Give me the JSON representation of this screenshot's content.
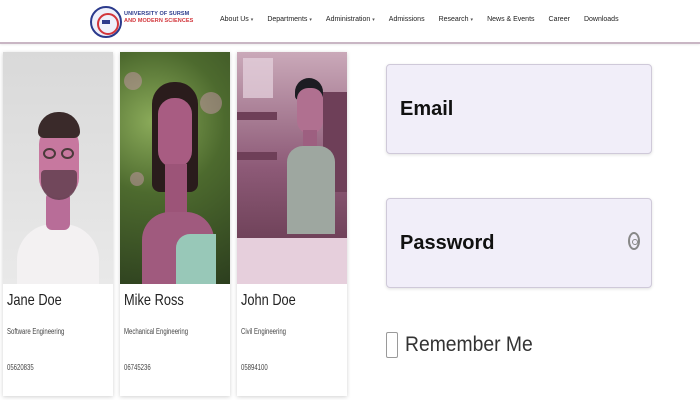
{
  "header": {
    "brand_line1": "UNIVERSITY OF SURSM",
    "brand_line2": "AND MODERN SCIENCES",
    "nav": [
      {
        "label": "About Us",
        "dropdown": true
      },
      {
        "label": "Departments",
        "dropdown": true
      },
      {
        "label": "Administration",
        "dropdown": true
      },
      {
        "label": "Admissions",
        "dropdown": false
      },
      {
        "label": "Research",
        "dropdown": true
      },
      {
        "label": "News & Events",
        "dropdown": false
      },
      {
        "label": "Career",
        "dropdown": false
      },
      {
        "label": "Downloads",
        "dropdown": false
      }
    ]
  },
  "cards": [
    {
      "name": "Jane Doe",
      "department": "Software Engineering",
      "code": "05620835"
    },
    {
      "name": "Mike Ross",
      "department": "Mechanical Engineering",
      "code": "06745236"
    },
    {
      "name": "John Doe",
      "department": "Civil Engineering",
      "code": "05894100"
    }
  ],
  "login": {
    "email_placeholder": "Email",
    "password_placeholder": "Password",
    "password_toggle_icon": "eye-icon",
    "remember_label": "Remember Me"
  },
  "colors": {
    "brand_blue": "#2b3a8c",
    "brand_red": "#d2353b",
    "field_bg": "#f1eef9"
  }
}
